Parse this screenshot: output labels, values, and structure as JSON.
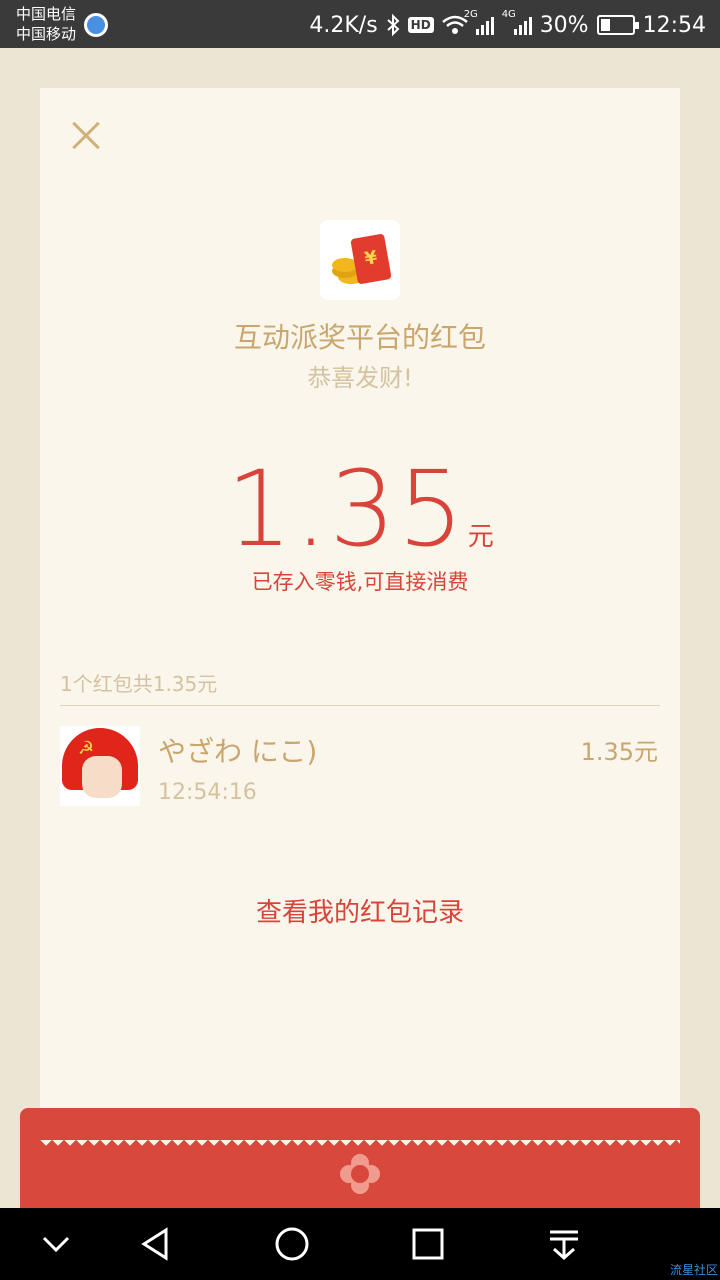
{
  "status_bar": {
    "carrier1": "中国电信",
    "carrier2": "中国移动",
    "speed": "4.2K/s",
    "hd": "HD",
    "net1": "2G",
    "net2": "4G",
    "battery": "30%",
    "battery_level": 0.3,
    "time": "12:54"
  },
  "packet": {
    "sender_title": "互动派奖平台的红包",
    "greeting": "恭喜发财!",
    "amount": "1.35",
    "unit": "元",
    "saved_note": "已存入零钱,可直接消费",
    "summary": "1个红包共1.35元"
  },
  "records": [
    {
      "name": "やざわ にこ)",
      "time": "12:54:16",
      "amount": "1.35元"
    }
  ],
  "view_records_label": "查看我的红包记录",
  "watermark": "流星社区",
  "colors": {
    "accent_red": "#d9443a",
    "gold": "#c9a66d",
    "card_bg": "#faf6ec",
    "page_bg": "#ece5d4"
  },
  "icons": {
    "close": "close-icon",
    "app": "red-envelope-icon",
    "flower": "flower-icon"
  }
}
